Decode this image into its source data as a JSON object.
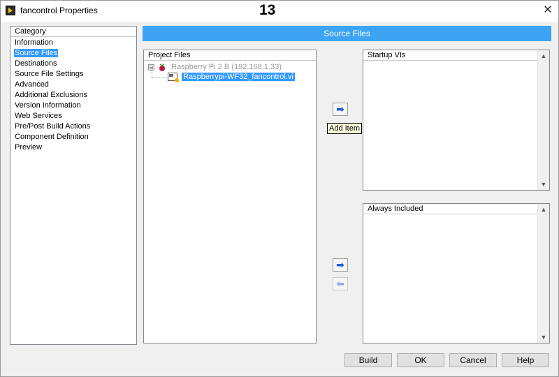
{
  "window": {
    "title": "fancontrol Properties",
    "step_number": "13",
    "close_glyph": "✕"
  },
  "category": {
    "header": "Category",
    "items": [
      {
        "label": "Information"
      },
      {
        "label": "Source Files",
        "selected": true
      },
      {
        "label": "Destinations"
      },
      {
        "label": "Source File Settings"
      },
      {
        "label": "Advanced"
      },
      {
        "label": "Additional Exclusions"
      },
      {
        "label": "Version Information"
      },
      {
        "label": "Web Services"
      },
      {
        "label": "Pre/Post Build Actions"
      },
      {
        "label": "Component Definition"
      },
      {
        "label": "Preview"
      }
    ]
  },
  "section": {
    "title": "Source Files"
  },
  "project_files": {
    "header": "Project Files",
    "target": "Raspberry Pi 2 B (192.168.1.33)",
    "target_icon": "raspberry-pi-icon",
    "expander": "⊟",
    "file": "Raspberrypi-WF32_fancontrol.vi",
    "file_icon": "vi-file-icon"
  },
  "transfer": {
    "add_glyph": "➡",
    "remove_glyph": "⬅",
    "tooltip": "Add Item"
  },
  "startup_vis": {
    "header": "Startup VIs"
  },
  "always_included": {
    "header": "Always Included"
  },
  "scroll": {
    "up": "▲",
    "down": "▼"
  },
  "buttons": {
    "build": "Build",
    "ok": "OK",
    "cancel": "Cancel",
    "help": "Help"
  },
  "colors": {
    "accent": "#3da4f4",
    "selection": "#3399ff",
    "arrow": "#1f5fd6"
  }
}
